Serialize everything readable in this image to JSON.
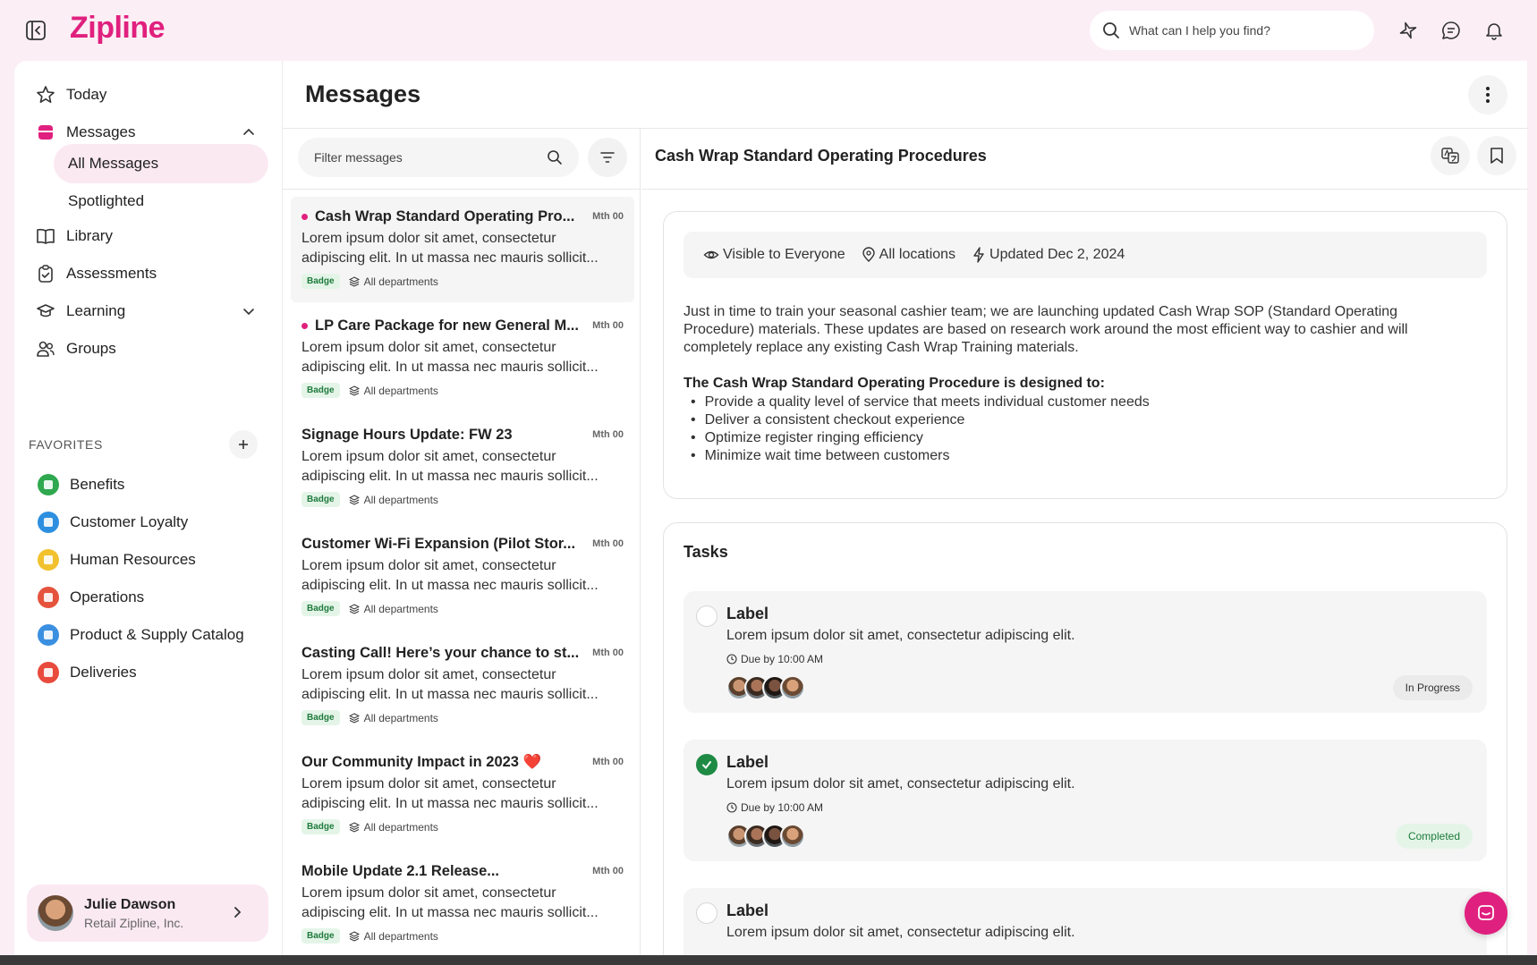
{
  "app": {
    "brand": "Zipline",
    "brand_color": "#e0207e"
  },
  "search": {
    "placeholder": "What can I help you find?"
  },
  "sidebar": {
    "nav": [
      {
        "label": "Today",
        "icon": "star-icon"
      },
      {
        "label": "Messages",
        "icon": "messages-icon"
      },
      {
        "label": "Library",
        "icon": "book-icon"
      },
      {
        "label": "Assessments",
        "icon": "clipboard-check-icon"
      },
      {
        "label": "Learning",
        "icon": "graduation-cap-icon"
      },
      {
        "label": "Groups",
        "icon": "users-icon"
      }
    ],
    "messages_sub": [
      "All Messages",
      "Spotlighted"
    ],
    "favorites_header": "FAVORITES",
    "favorites": [
      {
        "label": "Benefits",
        "color": "#2fa84f"
      },
      {
        "label": "Customer Loyalty",
        "color": "#2d8fe0"
      },
      {
        "label": "Human Resources",
        "color": "#f2c12e"
      },
      {
        "label": "Operations",
        "color": "#e5533c"
      },
      {
        "label": "Product & Supply Catalog",
        "color": "#3b8fe0"
      },
      {
        "label": "Deliveries",
        "color": "#e84a3c"
      }
    ],
    "profile": {
      "name": "Julie Dawson",
      "org": "Retail Zipline, Inc."
    }
  },
  "main": {
    "title": "Messages",
    "filter_placeholder": "Filter messages",
    "messages": [
      {
        "title": "Cash Wrap Standard Operating Pro...",
        "date": "Mth 00",
        "body": "Lorem ipsum dolor sit amet, consectetur adipiscing elit. In ut massa nec mauris sollicit...",
        "badge": "Badge",
        "dept": "All departments",
        "unread": true
      },
      {
        "title": "LP Care Package for new General M...",
        "date": "Mth 00",
        "body": "Lorem ipsum dolor sit amet, consectetur adipiscing elit. In ut massa nec mauris sollicit...",
        "badge": "Badge",
        "dept": "All departments",
        "unread": true
      },
      {
        "title": "Signage Hours Update: FW 23",
        "date": "Mth 00",
        "body": "Lorem ipsum dolor sit amet, consectetur adipiscing elit. In ut massa nec mauris sollicit...",
        "badge": "Badge",
        "dept": "All departments",
        "unread": false
      },
      {
        "title": "Customer Wi-Fi Expansion (Pilot Stor...",
        "date": "Mth 00",
        "body": "Lorem ipsum dolor sit amet, consectetur adipiscing elit. In ut massa nec mauris sollicit...",
        "badge": "Badge",
        "dept": "All departments",
        "unread": false
      },
      {
        "title": "Casting Call! Here’s your chance to st...",
        "date": "Mth 00",
        "body": "Lorem ipsum dolor sit amet, consectetur adipiscing elit. In ut massa nec mauris sollicit...",
        "badge": "Badge",
        "dept": "All departments",
        "unread": false
      },
      {
        "title": "Our Community Impact in 2023 ❤️",
        "date": "Mth 00",
        "body": "Lorem ipsum dolor sit amet, consectetur adipiscing elit. In ut massa nec mauris sollicit...",
        "badge": "Badge",
        "dept": "All departments",
        "unread": false
      },
      {
        "title": "Mobile Update 2.1 Release...",
        "date": "Mth 00",
        "body": "Lorem ipsum dolor sit amet, consectetur adipiscing elit. In ut massa nec mauris sollicit...",
        "badge": "Badge",
        "dept": "All departments",
        "unread": false
      }
    ]
  },
  "detail": {
    "title": "Cash Wrap Standard Operating Procedures",
    "visibility": "Visible to Everyone",
    "locations": "All locations",
    "updated": "Updated Dec 2, 2024",
    "paragraph": "Just in time to train your seasonal cashier team; we are launching updated Cash Wrap SOP (Standard Operating Procedure) materials. These updates are based on research work around the most efficient way to cashier and will completely replace any existing Cash Wrap Training materials.",
    "list_heading": "The Cash Wrap Standard Operating Procedure is designed to:",
    "bullets": [
      "Provide a quality level of service that meets individual customer needs",
      "Deliver a consistent checkout experience",
      "Optimize register ringing efficiency",
      "Minimize wait time between customers"
    ],
    "tasks_title": "Tasks",
    "tasks": [
      {
        "label": "Label",
        "desc": "Lorem ipsum dolor sit amet, consectetur adipiscing elit.",
        "due": "Due by 10:00 AM",
        "status": "In Progress",
        "done": false
      },
      {
        "label": "Label",
        "desc": "Lorem ipsum dolor sit amet, consectetur adipiscing elit.",
        "due": "Due by 10:00 AM",
        "status": "Completed",
        "done": true
      },
      {
        "label": "Label",
        "desc": "Lorem ipsum dolor sit amet, consectetur adipiscing elit.",
        "due": "",
        "status": "",
        "done": false
      }
    ]
  }
}
